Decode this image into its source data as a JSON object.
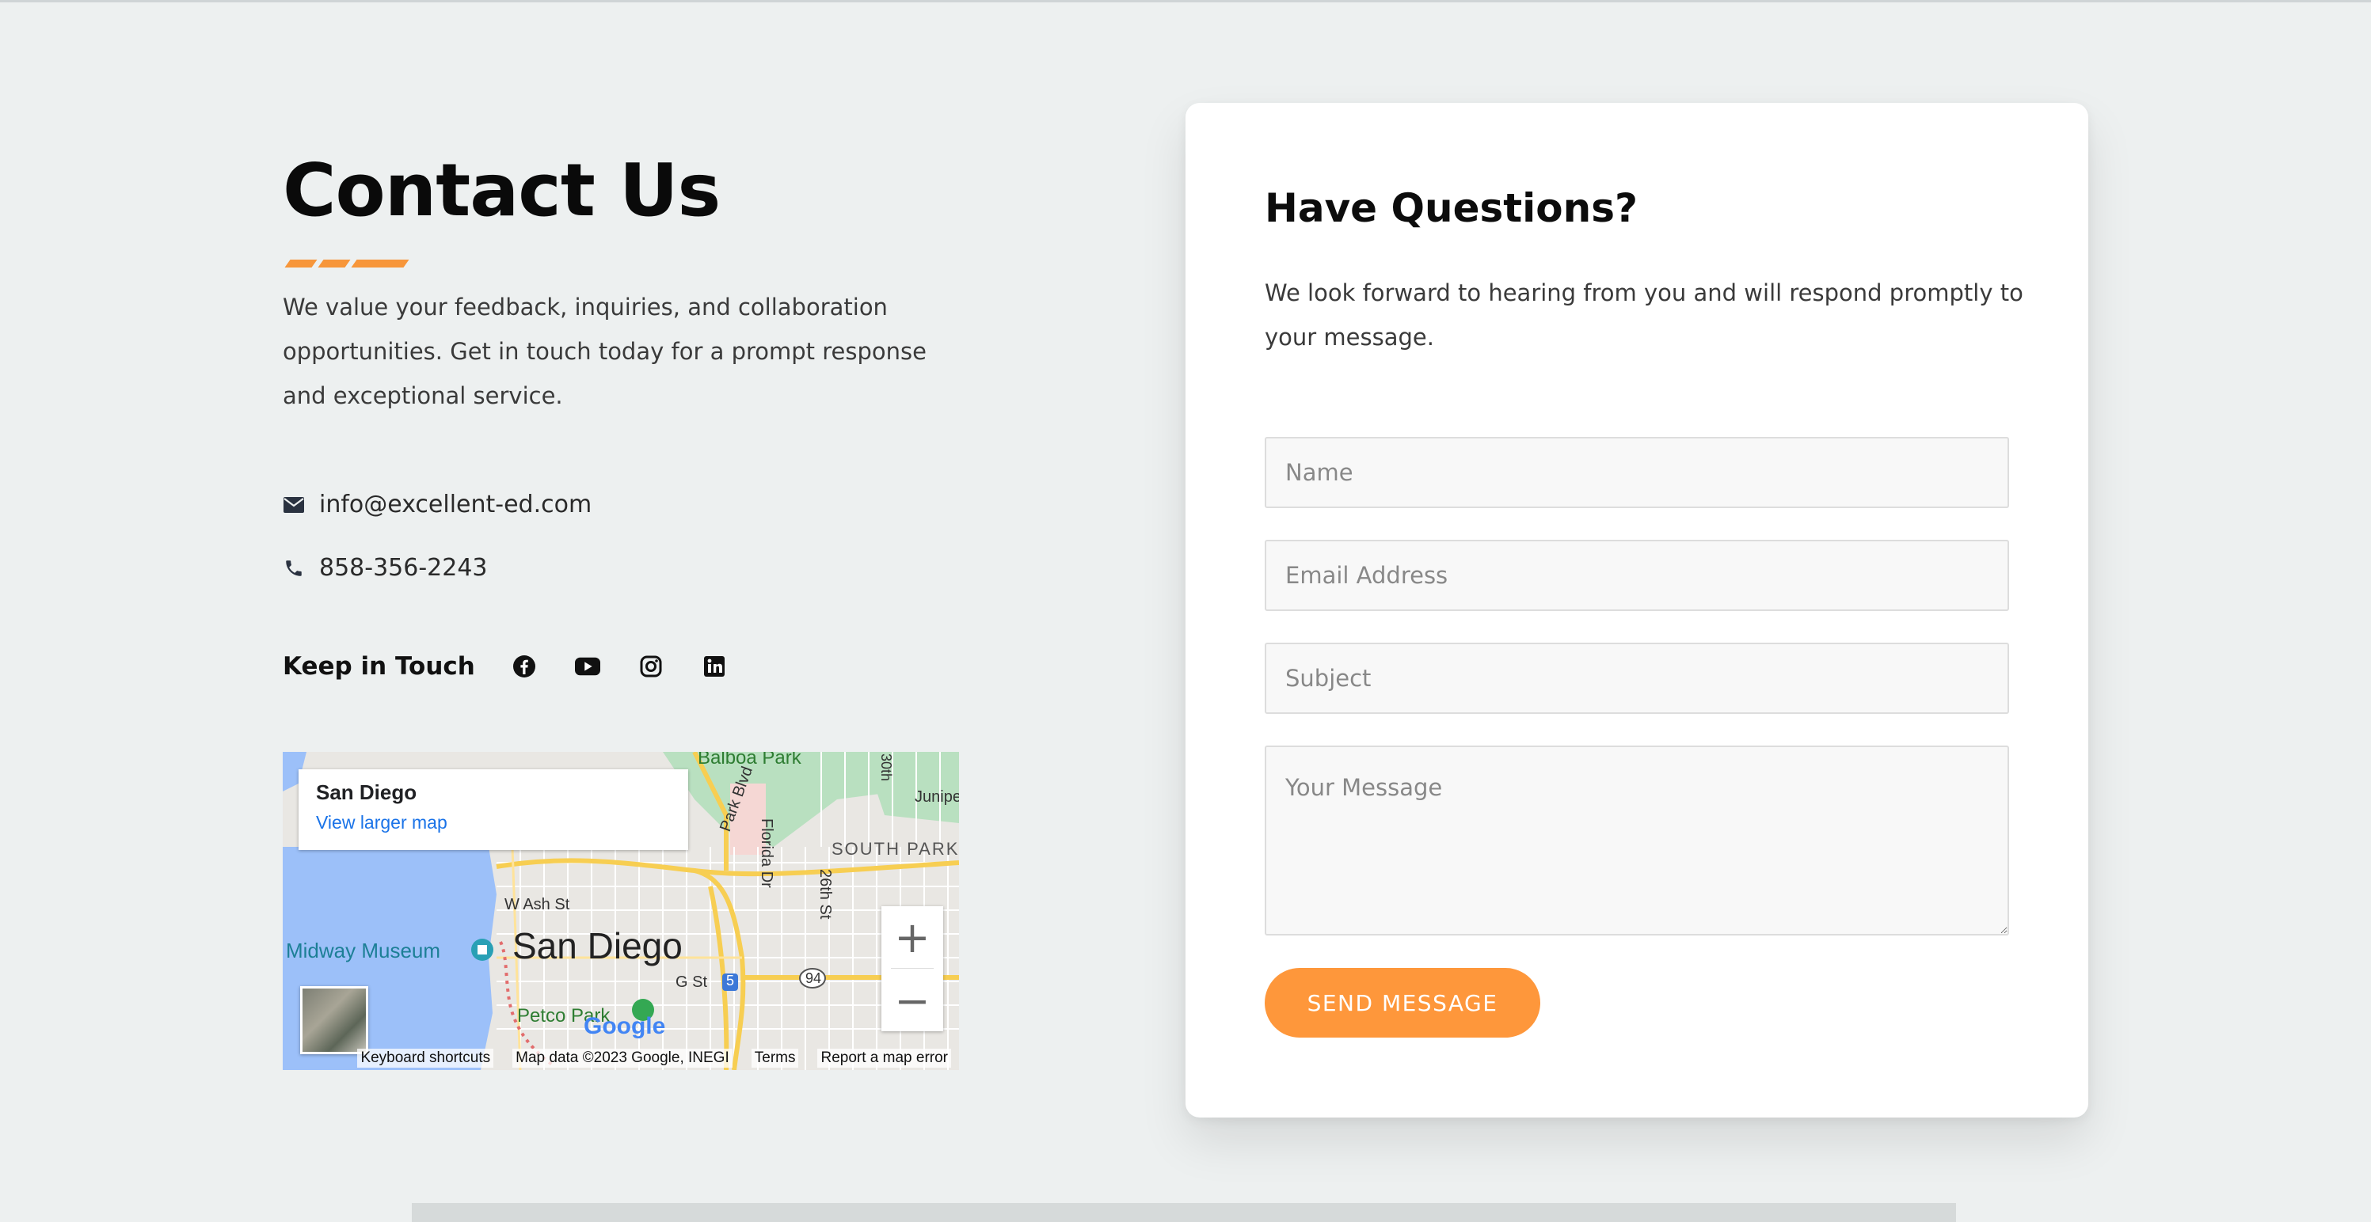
{
  "contact": {
    "title": "Contact Us",
    "lead": "We value your feedback, inquiries, and collaboration opportunities. Get in touch today for a prompt response and exceptional service.",
    "email": "info@excellent-ed.com",
    "phone": "858-356-2243",
    "keep_in_touch": "Keep in Touch",
    "social_icons": [
      "facebook-icon",
      "youtube-icon",
      "instagram-icon",
      "linkedin-icon"
    ]
  },
  "map": {
    "place_title": "San Diego",
    "view_larger": "View larger map",
    "city_label": "San Diego",
    "labels": {
      "balboa": "Balboa Park",
      "south_park": "SOUTH PARK",
      "midway": "Midway Museum",
      "petco": "Petco Park",
      "w_ash": "W Ash St",
      "g_st": "G St",
      "florida": "Florida Dr",
      "park_blvd": "Park Blvd",
      "st26": "26th St",
      "junipe": "Junipe",
      "i5": "5",
      "r94": "94",
      "st30": "30th"
    },
    "footer": {
      "shortcuts": "Keyboard shortcuts",
      "data": "Map data ©2023 Google, INEGI",
      "terms": "Terms",
      "report": "Report a map error"
    },
    "zoom_in": "+",
    "zoom_out": "−",
    "google": "Google"
  },
  "form": {
    "heading": "Have Questions?",
    "description": "We look forward to hearing from you and will respond promptly to your message.",
    "name_placeholder": "Name",
    "email_placeholder": "Email Address",
    "subject_placeholder": "Subject",
    "message_placeholder": "Your Message",
    "submit_label": "SEND MESSAGE"
  },
  "colors": {
    "accent": "#fe973b",
    "background": "#edf0f0",
    "link": "#1a73e8"
  }
}
